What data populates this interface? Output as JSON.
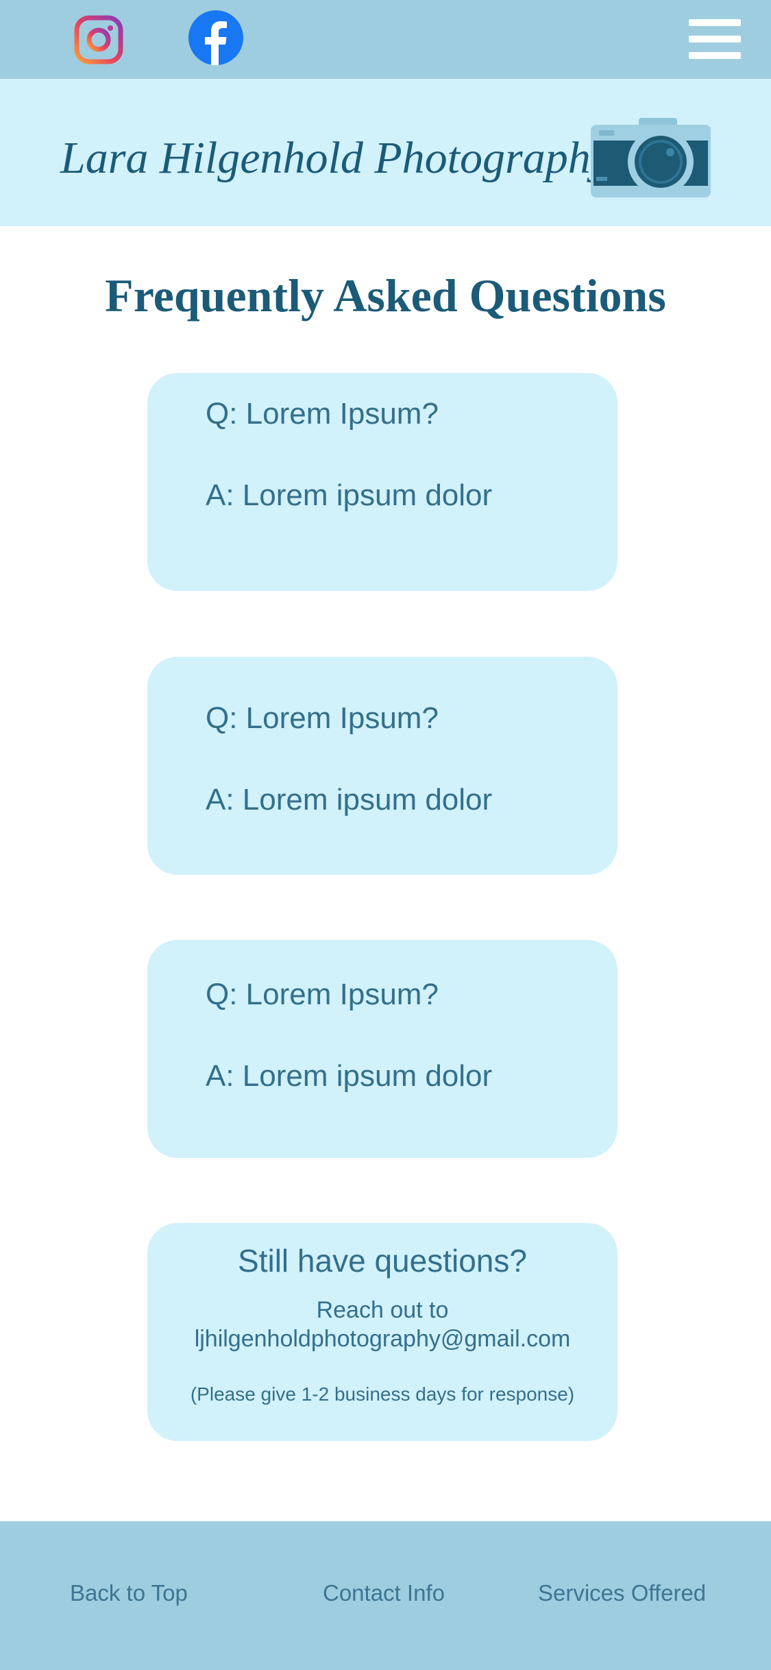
{
  "header": {
    "instagram_icon": "instagram-icon",
    "facebook_icon": "facebook-icon",
    "menu_icon": "hamburger-menu-icon"
  },
  "brand": {
    "title": "Lara Hilgenhold Photography",
    "logo_icon": "camera-icon"
  },
  "page": {
    "title": "Frequently Asked Questions"
  },
  "faq": [
    {
      "q_key": "Q:",
      "question": " Lorem Ipsum?",
      "a_key": "A:",
      "answer": " Lorem ipsum dolor"
    },
    {
      "q_key": "Q:",
      "question": " Lorem Ipsum?",
      "a_key": "A:",
      "answer": " Lorem ipsum dolor"
    },
    {
      "q_key": "Q:",
      "question": " Lorem Ipsum?",
      "a_key": "A:",
      "answer": " Lorem ipsum dolor"
    }
  ],
  "contact": {
    "heading": "Still have questions?",
    "line1": "Reach out to",
    "email": "ljhilgenholdphotography@gmail.com",
    "note": "(Please give 1-2 business days for response)"
  },
  "footer": {
    "back_to_top": "Back to Top",
    "contact_info": "Contact Info",
    "services": "Services Offered"
  },
  "colors": {
    "topbar": "#9ecde0",
    "light_panel": "#d1f1fb",
    "title_blue": "#1b5b78",
    "text_blue": "#336f8a",
    "facebook_blue": "#1877f2"
  }
}
